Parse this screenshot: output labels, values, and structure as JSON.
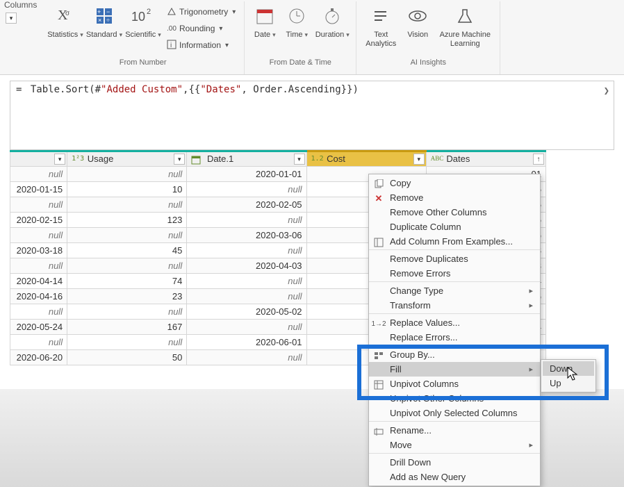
{
  "ribbon": {
    "columns_label": "Columns",
    "groups": {
      "from_number": {
        "label": "From Number",
        "statistics": "Statistics",
        "standard": "Standard",
        "scientific": "Scientific",
        "trig": "Trigonometry",
        "rounding": "Rounding",
        "information": "Information"
      },
      "from_datetime": {
        "label": "From Date & Time",
        "date": "Date",
        "time": "Time",
        "duration": "Duration"
      },
      "ai_insights": {
        "label": "AI Insights",
        "text_analytics": "Text\nAnalytics",
        "vision": "Vision",
        "aml": "Azure Machine\nLearning"
      }
    }
  },
  "formula": {
    "eq": "=",
    "fn": "Table.Sort",
    "open": "(#",
    "arg1": "\"Added Custom\"",
    "mid": ",{{",
    "arg2": "\"Dates\"",
    "tail": ", Order.Ascending}})"
  },
  "columns": {
    "c0_drop": "▾",
    "usage": "Usage",
    "usage_type": "1²3",
    "date1": "Date.1",
    "cost": "Cost",
    "cost_type": "1.2",
    "dates": "Dates",
    "dates_type": "ABC"
  },
  "rows": [
    {
      "c0": "null",
      "usage": "null",
      "date1": "2020-01-01",
      "cost_tail": "01"
    },
    {
      "c0": "2020-01-15",
      "usage": "10",
      "date1": "null",
      "cost_tail": "5"
    },
    {
      "c0": "null",
      "usage": "null",
      "date1": "2020-02-05",
      "cost_tail": "5"
    },
    {
      "c0": "2020-02-15",
      "usage": "123",
      "date1": "null",
      "cost_tail": "5"
    },
    {
      "c0": "null",
      "usage": "null",
      "date1": "2020-03-06",
      "cost_tail": "06"
    },
    {
      "c0": "2020-03-18",
      "usage": "45",
      "date1": "null",
      "cost_tail": "8"
    },
    {
      "c0": "null",
      "usage": "null",
      "date1": "2020-04-03",
      "cost_tail": "03"
    },
    {
      "c0": "2020-04-14",
      "usage": "74",
      "date1": "null",
      "cost_tail": "4"
    },
    {
      "c0": "2020-04-16",
      "usage": "23",
      "date1": "null",
      "cost_tail": "6"
    },
    {
      "c0": "null",
      "usage": "null",
      "date1": "2020-05-02",
      "cost_tail": ""
    },
    {
      "c0": "2020-05-24",
      "usage": "167",
      "date1": "null",
      "cost_tail": "4"
    },
    {
      "c0": "null",
      "usage": "null",
      "date1": "2020-06-01",
      "cost_tail": ""
    },
    {
      "c0": "2020-06-20",
      "usage": "50",
      "date1": "null",
      "cost_tail": ""
    }
  ],
  "context_menu": {
    "copy": "Copy",
    "remove": "Remove",
    "remove_other": "Remove Other Columns",
    "duplicate": "Duplicate Column",
    "add_from_ex": "Add Column From Examples...",
    "remove_dup": "Remove Duplicates",
    "remove_err": "Remove Errors",
    "change_type": "Change Type",
    "transform": "Transform",
    "replace_val": "Replace Values...",
    "replace_err": "Replace Errors...",
    "group_by": "Group By...",
    "fill": "Fill",
    "unpivot": "Unpivot Columns",
    "unpivot_other": "Unpivot Other Columns",
    "unpivot_sel": "Unpivot Only Selected Columns",
    "rename": "Rename...",
    "move": "Move",
    "drill": "Drill Down",
    "add_query": "Add as New Query"
  },
  "submenu": {
    "down": "Down",
    "up": "Up"
  }
}
